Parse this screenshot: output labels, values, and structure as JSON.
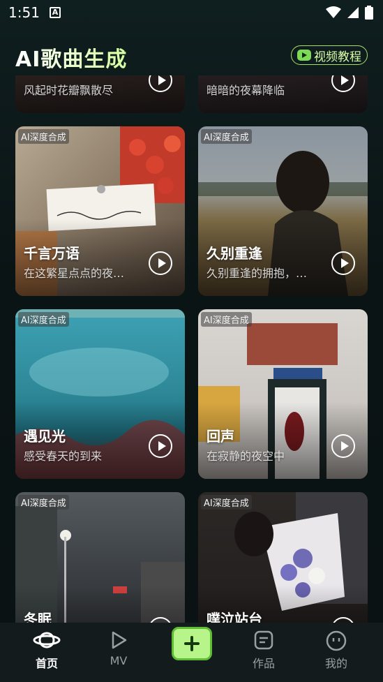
{
  "status_bar": {
    "time": "1:51",
    "notification_glyph": "A"
  },
  "header": {
    "title": "AI歌曲生成",
    "tutorial_label": "视频教程"
  },
  "cards": [
    {
      "tag": "",
      "title": "",
      "subtitle": "风起时花瓣飘散尽",
      "palette": "#3b2c28"
    },
    {
      "tag": "",
      "title": "",
      "subtitle": "暗暗的夜幕降临",
      "palette": "#3a2e30"
    },
    {
      "tag": "AI深度合成",
      "title": "千言万语",
      "subtitle": "在这繁星点点的夜…",
      "palette": "#8a7a66"
    },
    {
      "tag": "AI深度合成",
      "title": "久别重逢",
      "subtitle": "久别重逢的拥抱，…",
      "palette": "#6d5a42"
    },
    {
      "tag": "AI深度合成",
      "title": "遇见光",
      "subtitle": "感受春天的到来",
      "palette": "#2d8fa0"
    },
    {
      "tag": "AI深度合成",
      "title": "回声",
      "subtitle": "在寂静的夜空中",
      "palette": "#b9b2ad"
    },
    {
      "tag": "AI深度合成",
      "title": "冬眠",
      "subtitle": "",
      "palette": "#2f3436"
    },
    {
      "tag": "AI深度合成",
      "title": "噗泣站台",
      "subtitle": "",
      "palette": "#2e2a2a"
    }
  ],
  "bottom_nav": {
    "home": "首页",
    "mv": "MV",
    "works": "作品",
    "mine": "我的"
  },
  "icons": {
    "home": "planet-icon",
    "mv": "play-triangle-icon",
    "create": "plus-icon",
    "works": "document-icon",
    "mine": "smiley-icon",
    "tutorial": "video-icon"
  },
  "colors": {
    "accent": "#b7f58a",
    "accent_border": "#5fbd35",
    "title_gradient_end": "#d6ff9f"
  }
}
